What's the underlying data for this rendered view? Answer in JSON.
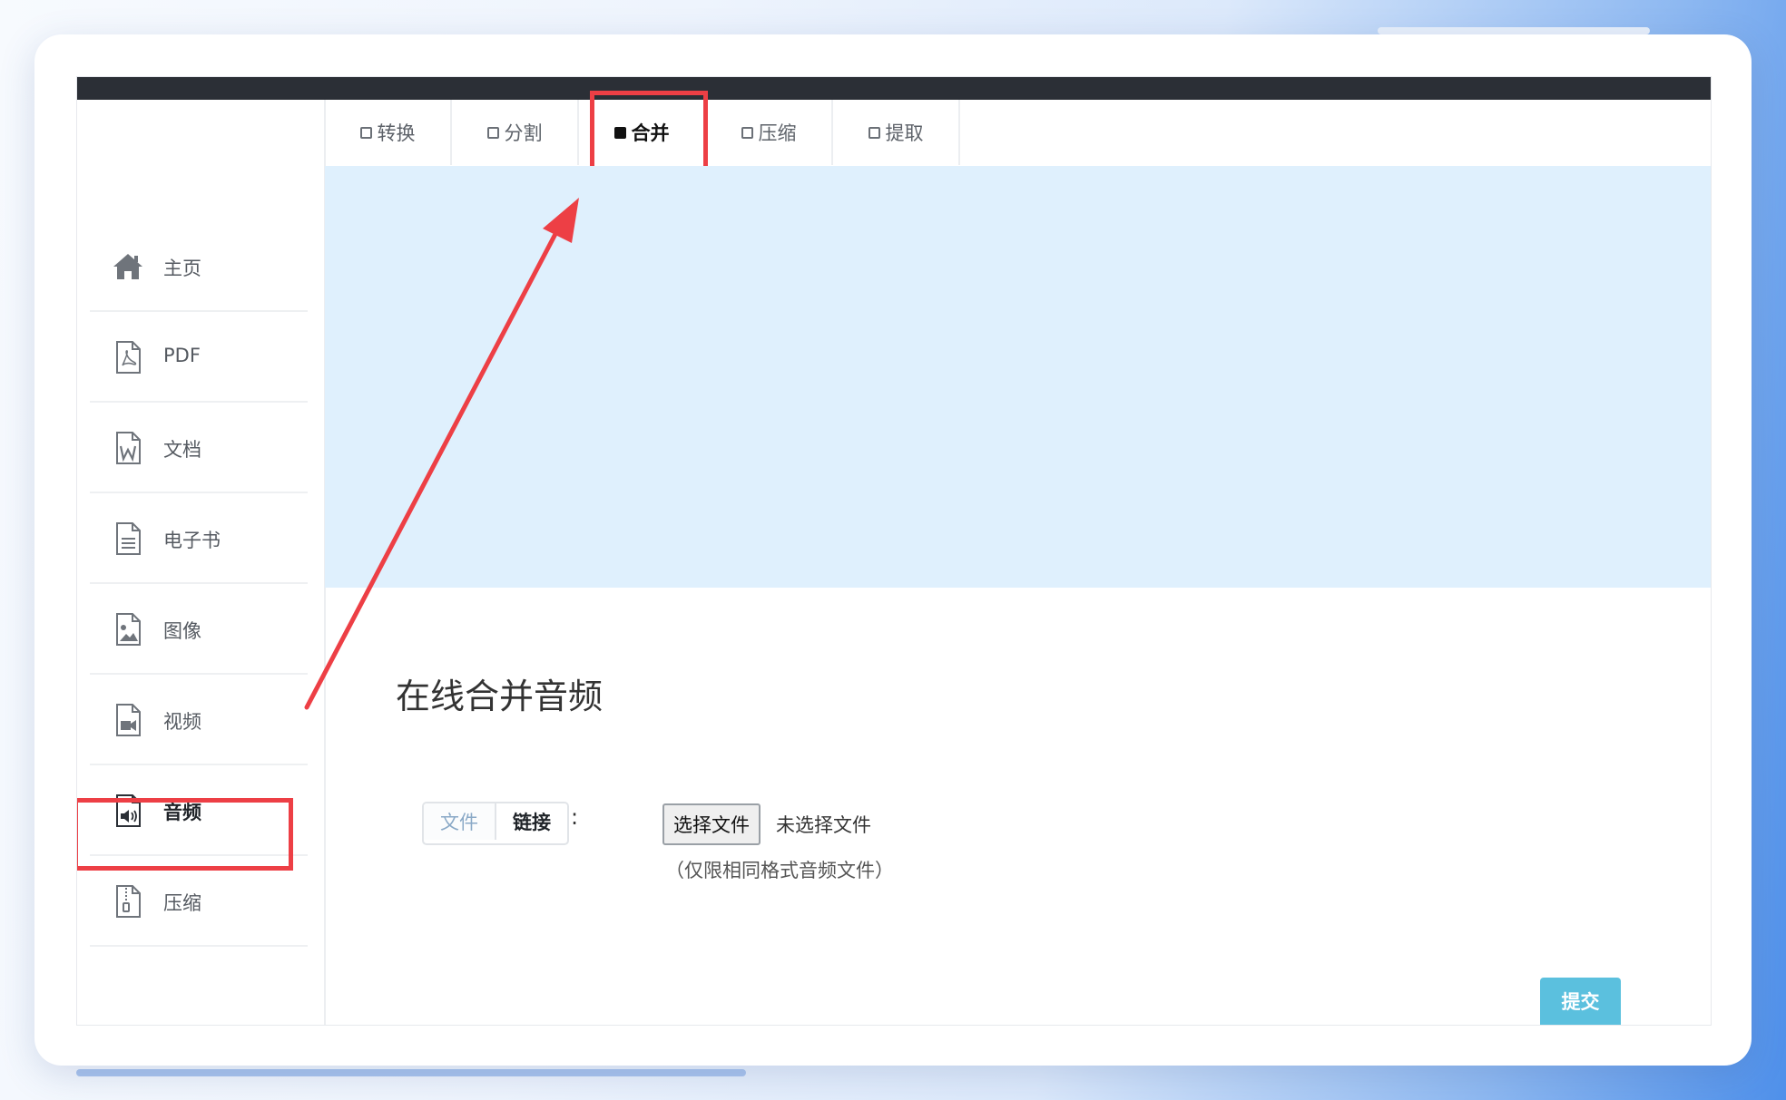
{
  "tabs": [
    {
      "label": "转换",
      "active": false
    },
    {
      "label": "分割",
      "active": false
    },
    {
      "label": "合并",
      "active": true
    },
    {
      "label": "压缩",
      "active": false
    },
    {
      "label": "提取",
      "active": false
    }
  ],
  "sidebar": {
    "items": [
      {
        "label": "主页",
        "icon": "home-icon"
      },
      {
        "label": "PDF",
        "icon": "pdf-file-icon"
      },
      {
        "label": "文档",
        "icon": "word-file-icon"
      },
      {
        "label": "电子书",
        "icon": "ebook-file-icon"
      },
      {
        "label": "图像",
        "icon": "image-file-icon"
      },
      {
        "label": "视频",
        "icon": "video-file-icon"
      },
      {
        "label": "音频",
        "icon": "audio-file-icon",
        "active": true
      },
      {
        "label": "压缩",
        "icon": "archive-file-icon"
      }
    ]
  },
  "main": {
    "title": "在线合并音频",
    "source_tabs": {
      "file": "文件",
      "link": "链接"
    },
    "colon": ":",
    "choose_file_button": "选择文件",
    "file_status": "未选择文件",
    "hint": "（仅限相同格式音频文件）",
    "submit_label": "提交"
  },
  "colors": {
    "highlight": "#ed3f45",
    "banner": "#dff0fd",
    "topbar": "#2b2f36",
    "submit": "#5bc0de"
  }
}
